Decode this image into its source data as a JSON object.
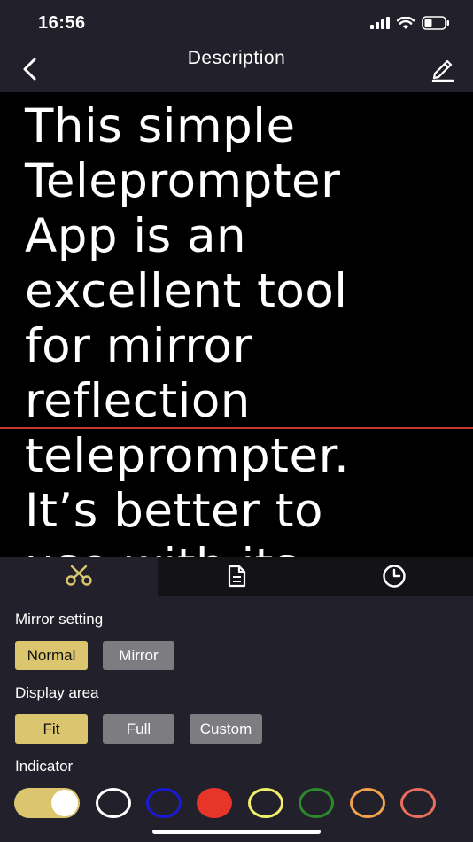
{
  "status_bar": {
    "time": "16:56"
  },
  "nav": {
    "title": "Description"
  },
  "script": {
    "lines": [
      "This simple",
      "Teleprompter",
      "App is an",
      "excellent tool",
      "for mirror",
      "reflection",
      "teleprompter.",
      "It’s better to",
      "use with its"
    ]
  },
  "tabs": [
    {
      "icon": "scissors-icon",
      "active": true
    },
    {
      "icon": "document-icon",
      "active": false
    },
    {
      "icon": "clock-icon",
      "active": false
    }
  ],
  "mirror_setting": {
    "label": "Mirror setting",
    "options": [
      "Normal",
      "Mirror"
    ],
    "selected": "Normal"
  },
  "display_area": {
    "label": "Display area",
    "options": [
      "Fit",
      "Full",
      "Custom"
    ],
    "selected": "Fit"
  },
  "indicator": {
    "label": "Indicator",
    "enabled": true,
    "colors": [
      "#ffffff",
      "#1a1ad6",
      "#e8352a",
      "#f2f06a",
      "#2b8a2b",
      "#f2a24a",
      "#ec6f5e"
    ],
    "selected_color": "#e8352a"
  },
  "colors": {
    "accent": "#dbc66f",
    "background": "#22212b",
    "indicator_line": "#c8352a"
  }
}
